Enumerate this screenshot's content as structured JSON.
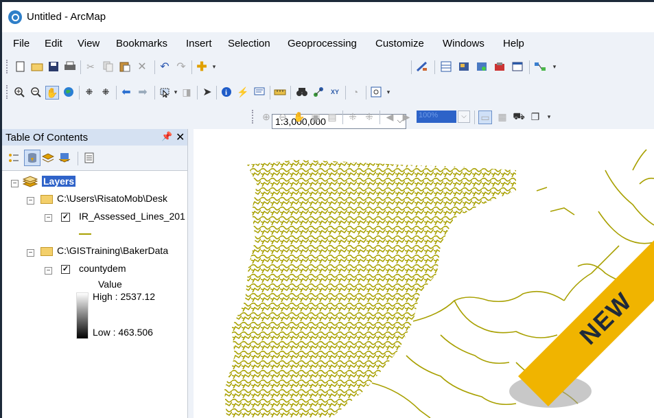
{
  "window": {
    "title": "Untitled - ArcMap"
  },
  "menu": {
    "items": [
      "File",
      "Edit",
      "View",
      "Bookmarks",
      "Insert",
      "Selection",
      "Geoprocessing",
      "Customize",
      "Windows",
      "Help"
    ]
  },
  "toolbar": {
    "scale_value": "1:3,000,000",
    "zoom_percent": "100%"
  },
  "toc": {
    "title": "Table Of Contents",
    "root_label": "Layers",
    "group1_path": "C:\\Users\\RisatoMob\\Desk",
    "layer1_name": "IR_Assessed_Lines_201",
    "group2_path": "C:\\GISTraining\\BakerData",
    "layer2_name": "countydem",
    "legend_title": "Value",
    "legend_high": "High : 2537.12",
    "legend_low": "Low : 463.506"
  },
  "badge": {
    "text": "NEW"
  },
  "colors": {
    "stream": "#a8a000",
    "toc_header": "#d5e1f2",
    "ribbon": "#f0b400"
  },
  "icons": [
    "new-document-icon",
    "open-folder-icon",
    "save-icon",
    "print-icon",
    "cut-icon",
    "copy-icon",
    "paste-icon",
    "delete-icon",
    "undo-icon",
    "redo-icon",
    "add-data-icon",
    "zoom-in-icon",
    "zoom-out-icon",
    "pan-icon",
    "full-extent-icon",
    "back-icon",
    "forward-icon",
    "select-icon",
    "identify-icon",
    "find-icon",
    "pin-icon",
    "close-icon"
  ]
}
